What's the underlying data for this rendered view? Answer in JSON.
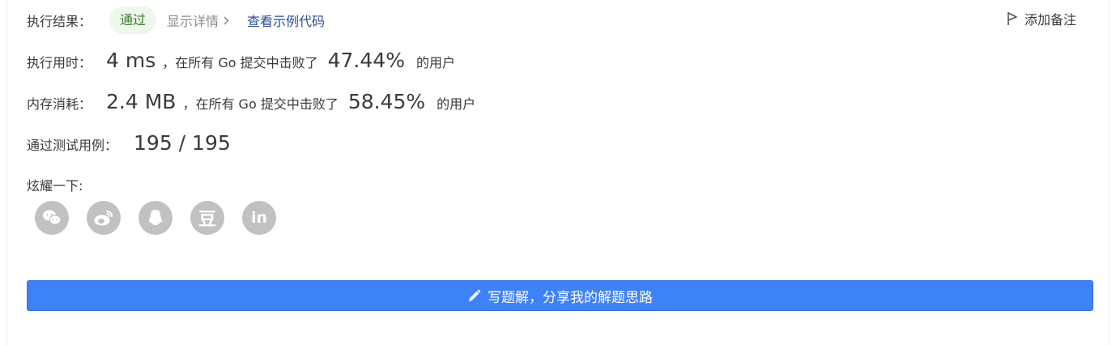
{
  "result": {
    "label": "执行结果：",
    "status": "通过",
    "details_link": "显示详情",
    "example_link": "查看示例代码"
  },
  "note_button": {
    "label": "添加备注",
    "icon": "flag-icon"
  },
  "runtime": {
    "label": "执行用时：",
    "value": "4 ms",
    "middle_text": "，在所有 Go 提交中击败了",
    "percent": "47.44%",
    "suffix": "的用户"
  },
  "memory": {
    "label": "内存消耗：",
    "value": "2.4 MB",
    "middle_text": "，在所有 Go 提交中击败了",
    "percent": "58.45%",
    "suffix": "的用户"
  },
  "tests": {
    "label": "通过测试用例：",
    "value": "195 / 195"
  },
  "share": {
    "label": "炫耀一下:",
    "icons": [
      "wechat-icon",
      "weibo-icon",
      "qq-icon",
      "douban-icon",
      "linkedin-icon"
    ],
    "douban_glyph": "豆",
    "linkedin_glyph": "in"
  },
  "write_solution_button": {
    "label": "写题解，分享我的解题思路",
    "icon": "pencil-icon"
  },
  "colors": {
    "primary_button": "#3e82f7",
    "pass_badge_bg": "#eef7ec",
    "pass_badge_text": "#3b7d2f",
    "link": "#2b4e93",
    "share_icon_bg": "#c1c1c1"
  }
}
